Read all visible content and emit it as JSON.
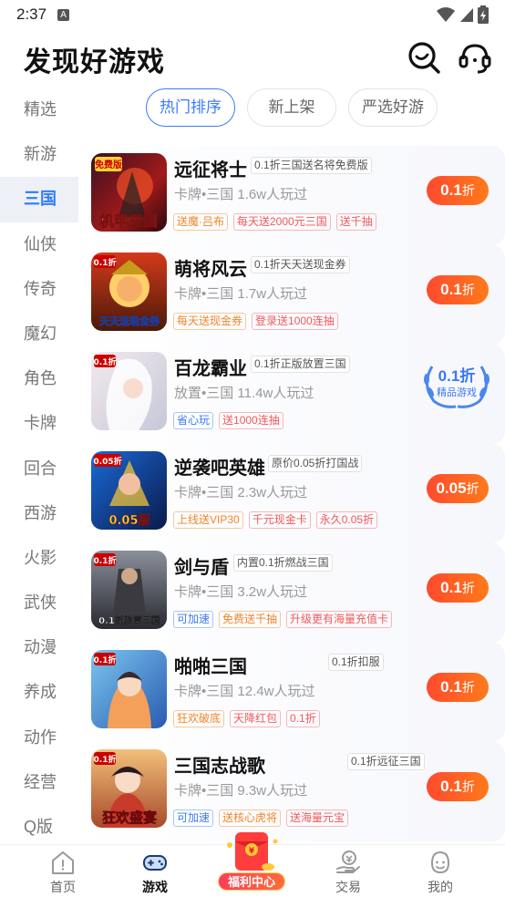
{
  "status_bar": {
    "time": "2:37",
    "notif_icon": "A"
  },
  "header": {
    "title": "发现好游戏"
  },
  "sidebar": {
    "items": [
      "精选",
      "新游",
      "三国",
      "仙侠",
      "传奇",
      "魔幻",
      "角色",
      "卡牌",
      "回合",
      "西游",
      "火影",
      "武侠",
      "动漫",
      "养成",
      "动作",
      "经营",
      "Q版"
    ],
    "active": "三国"
  },
  "tabs": [
    "热门排序",
    "新上架",
    "严选好游"
  ],
  "games": [
    {
      "name": "远征将士",
      "promo": "0.1折三国送名将免费版",
      "meta": "卡牌•三国  1.6w人玩过",
      "tags": [
        {
          "t": "送魔·吕布",
          "c": "orange"
        },
        {
          "t": "每天送2000元三国",
          "c": "red"
        },
        {
          "t": "送千抽",
          "c": "red"
        }
      ],
      "discount": "0.1",
      "unit": "折",
      "thumb_text": "机甲三国",
      "thumb_badge": "免费版"
    },
    {
      "name": "萌将风云",
      "promo": "0.1折天天送现金券",
      "meta": "卡牌•三国  1.7w人玩过",
      "tags": [
        {
          "t": "每天送现金券",
          "c": "orange"
        },
        {
          "t": "登录送1000连抽",
          "c": "red"
        }
      ],
      "discount": "0.1",
      "unit": "折",
      "thumb_text": "天天送现金券",
      "thumb_badge": "0.1折"
    },
    {
      "name": "百龙霸业",
      "promo": "0.1折正版放置三国",
      "meta": "放置•三国  11.4w人玩过",
      "tags": [
        {
          "t": "省心玩",
          "c": "blue"
        },
        {
          "t": "送1000连抽",
          "c": "red"
        }
      ],
      "badge_value": "0.1折",
      "badge_text": "精品游戏",
      "thumb_text": "",
      "thumb_badge": "0.1折"
    },
    {
      "name": "逆袭吧英雄",
      "promo": "原价0.05折打国战",
      "meta": "卡牌•三国  2.3w人玩过",
      "tags": [
        {
          "t": "上线送VIP30",
          "c": "orange"
        },
        {
          "t": "千元现金卡",
          "c": "red"
        },
        {
          "t": "永久0.05折",
          "c": "red"
        }
      ],
      "discount": "0.05",
      "unit": "折",
      "thumb_text": "0.05版",
      "thumb_badge": "0.05折"
    },
    {
      "name": "剑与盾",
      "promo": "内置0.1折燃战三国",
      "meta": "卡牌•三国  3.2w人玩过",
      "tags": [
        {
          "t": "可加速",
          "c": "blue"
        },
        {
          "t": "免费送千抽",
          "c": "orange"
        },
        {
          "t": "升级更有海量充值卡",
          "c": "red"
        }
      ],
      "discount": "0.1",
      "unit": "折",
      "thumb_text": "0.1折放置三国",
      "thumb_badge": "0.1折"
    },
    {
      "name": "啪啪三国",
      "promo": "0.1折扣服",
      "meta": "卡牌•三国  12.4w人玩过",
      "tags": [
        {
          "t": "狂欢破底",
          "c": "orange"
        },
        {
          "t": "天降红包",
          "c": "red"
        },
        {
          "t": "0.1折",
          "c": "red"
        }
      ],
      "discount": "0.1",
      "unit": "折",
      "thumb_text": "",
      "thumb_badge": "0.1折"
    },
    {
      "name": "三国志战歌",
      "promo": "0.1折远征三国",
      "meta": "卡牌•三国  9.3w人玩过",
      "tags": [
        {
          "t": "可加速",
          "c": "blue"
        },
        {
          "t": "送核心虎将",
          "c": "orange"
        },
        {
          "t": "送海量元宝",
          "c": "red"
        }
      ],
      "discount": "0.1",
      "unit": "折",
      "thumb_text": "狂欢盛宴",
      "thumb_badge": "0.1折"
    }
  ],
  "bottom_nav": {
    "home": "首页",
    "games": "游戏",
    "welfare": "福利中心",
    "trade": "交易",
    "me": "我的"
  },
  "colors": {
    "accent": "#2f7bff",
    "discount": "#ff5a25"
  }
}
